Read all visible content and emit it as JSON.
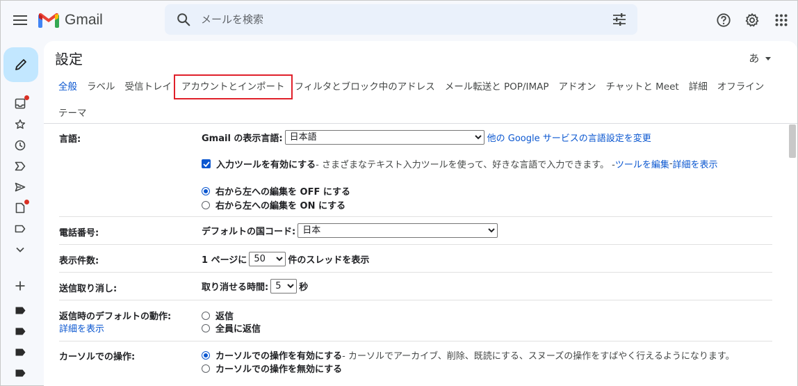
{
  "app": {
    "name": "Gmail"
  },
  "search": {
    "placeholder": "メールを検索"
  },
  "settings": {
    "title": "設定",
    "input_tool_char": "あ"
  },
  "tabs": {
    "row1": [
      "全般",
      "ラベル",
      "受信トレイ",
      "アカウントとインポート",
      "フィルタとブロック中のアドレス",
      "メール転送と POP/IMAP",
      "アドオン",
      "チャットと Meet",
      "詳細",
      "オフライン"
    ],
    "row2": [
      "テーマ"
    ],
    "active": "全般",
    "highlighted": "アカウントとインポート"
  },
  "language": {
    "label": "言語:",
    "display_label": "Gmail の表示言語:",
    "display_value": "日本語",
    "change_link": "他の Google サービスの言語設定を変更",
    "input_tools_label": "入力ツールを有効にする",
    "input_tools_desc": " - さまざまなテキスト入力ツールを使って、好きな言語で入力できます。 - ",
    "edit_tools_link": "ツールを編集",
    "dash": " - ",
    "details_link": "詳細を表示",
    "rtl_off": "右から左への編集を OFF にする",
    "rtl_on": "右から左への編集を ON にする"
  },
  "phone": {
    "label": "電話番号:",
    "country_label": "デフォルトの国コード:",
    "country_value": "日本"
  },
  "page_size": {
    "label": "表示件数:",
    "prefix": "1 ページに",
    "value": "50",
    "suffix": "件のスレッドを表示"
  },
  "undo_send": {
    "label": "送信取り消し:",
    "prefix": "取り消せる時間:",
    "value": "5",
    "suffix": "秒"
  },
  "reply": {
    "label": "返信時のデフォルトの動作:",
    "details_link": "詳細を表示",
    "option1": "返信",
    "option2": "全員に返信"
  },
  "cursor": {
    "label": "カーソルでの操作:",
    "enable_label": "カーソルでの操作を有効にする",
    "enable_desc": " - カーソルでアーカイブ、削除、既読にする、スヌーズの操作をすばやく行えるようになります。",
    "disable_label": "カーソルでの操作を無効にする"
  }
}
